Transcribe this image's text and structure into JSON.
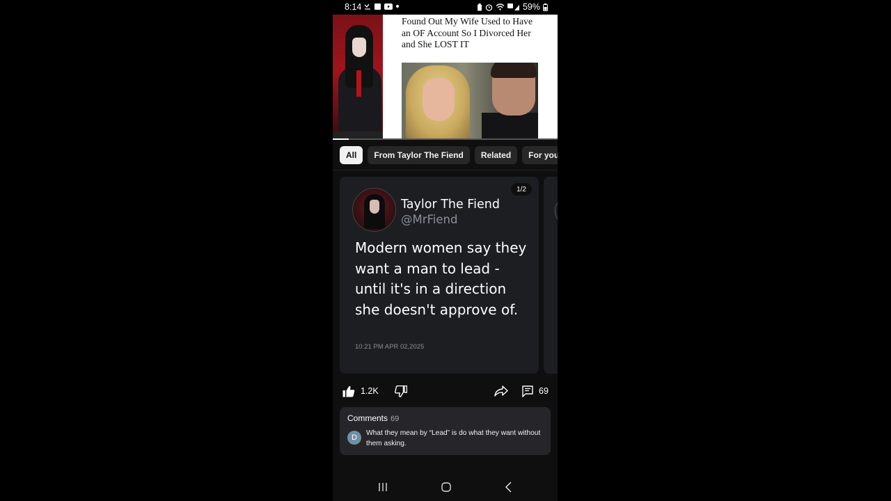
{
  "status_bar": {
    "time": "8:14",
    "battery": "59%"
  },
  "video": {
    "title": "Found Out My Wife Used to Have an OF Account So I Divorced Her and She LOST IT",
    "progress": 0.07
  },
  "chips": [
    {
      "label": "All",
      "active": true
    },
    {
      "label": "From Taylor The Fiend",
      "active": false
    },
    {
      "label": "Related",
      "active": false
    },
    {
      "label": "For you",
      "active": false
    }
  ],
  "post": {
    "page_indicator": "1/2",
    "author_name": "Taylor The Fiend",
    "author_handle": "@MrFiend",
    "text": "Modern women say they want a man to lead - until it's in a direction she doesn't approve of.",
    "timestamp": "10:21 PM  APR 02,2025"
  },
  "actions": {
    "like_count": "1.2K",
    "comment_count": "69"
  },
  "comments": {
    "header": "Comments",
    "count": "69",
    "first_comment": {
      "avatar_letter": "D",
      "text": "What they mean by “Lead” is do what they want without them asking."
    }
  },
  "icons": {
    "like": "thumbs-up-icon",
    "dislike": "thumbs-down-icon",
    "share": "share-icon",
    "comments": "comments-icon",
    "nav_recent": "recent-apps-icon",
    "nav_home": "home-icon",
    "nav_back": "back-icon"
  },
  "colors": {
    "background": "#0f0f10",
    "card": "#1c1e22",
    "chip": "#272727",
    "chip_active": "#f1f1f1",
    "muted_text": "#8a8f99"
  }
}
